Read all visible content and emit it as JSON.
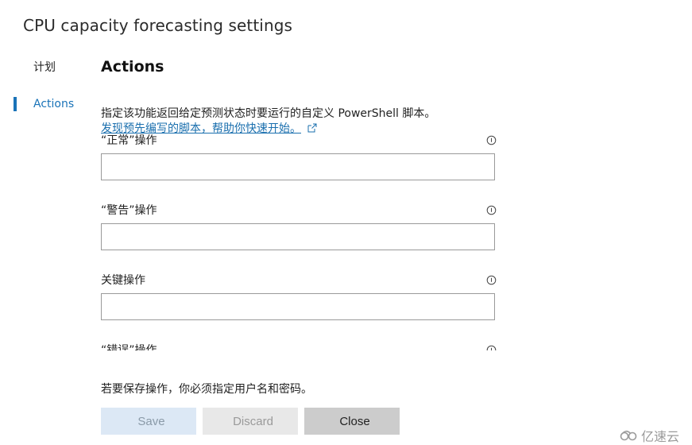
{
  "page": {
    "title": "CPU capacity forecasting settings"
  },
  "nav": {
    "items": [
      {
        "label": "计划",
        "active": false
      },
      {
        "label": "Actions",
        "active": true
      }
    ]
  },
  "section": {
    "title": "Actions",
    "description": "指定该功能返回给定预测状态时要运行的自定义 PowerShell 脚本。",
    "link_text": "发现预先编写的脚本，帮助你快速开始。"
  },
  "fields": [
    {
      "label": "“正常”操作",
      "value": ""
    },
    {
      "label": "“警告”操作",
      "value": ""
    },
    {
      "label": "关键操作",
      "value": ""
    },
    {
      "label": "“错误”操作",
      "value": ""
    }
  ],
  "footer": {
    "note": "若要保存操作，你必须指定用户名和密码。",
    "save_label": "Save",
    "discard_label": "Discard",
    "close_label": "Close"
  },
  "watermark": {
    "text": "亿速云"
  }
}
